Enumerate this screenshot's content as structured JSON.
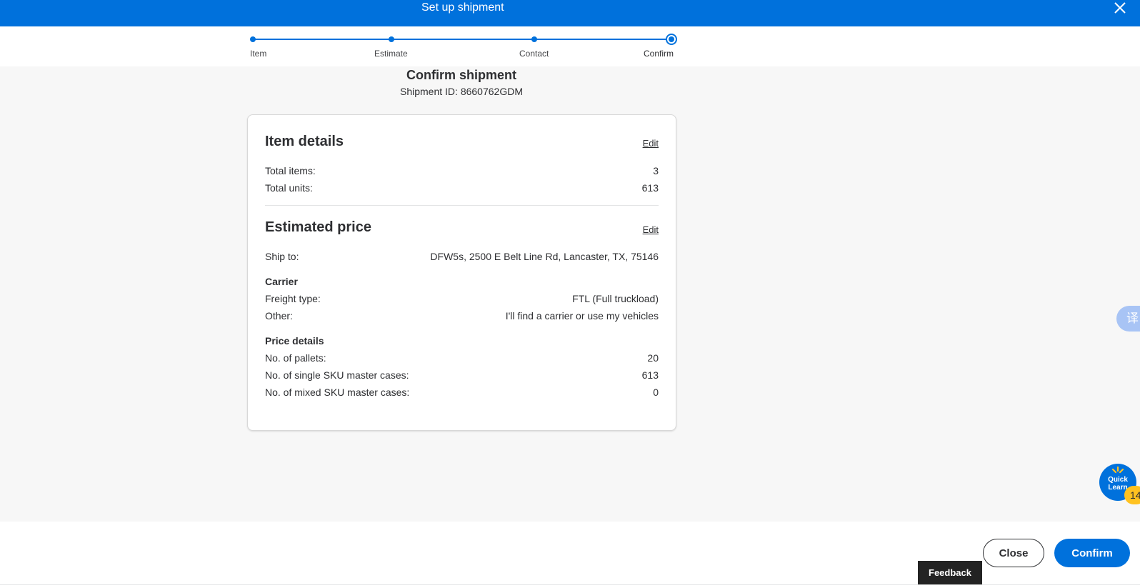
{
  "header": {
    "title": "Set up shipment"
  },
  "stepper": {
    "steps": [
      {
        "label": "Item"
      },
      {
        "label": "Estimate"
      },
      {
        "label": "Contact"
      },
      {
        "label": "Confirm"
      }
    ],
    "current_step": 4
  },
  "page": {
    "title": "Confirm shipment",
    "shipment_id": "Shipment ID: 8660762GDM"
  },
  "item_details": {
    "title": "Item details",
    "edit_label": "Edit",
    "total_items_label": "Total items:",
    "total_items_value": "3",
    "total_units_label": "Total units:",
    "total_units_value": "613"
  },
  "estimated_price": {
    "title": "Estimated price",
    "edit_label": "Edit",
    "ship_to_label": "Ship to:",
    "ship_to_value": "DFW5s, 2500 E Belt Line Rd, Lancaster, TX, 75146",
    "carrier_heading": "Carrier",
    "freight_type_label": "Freight type:",
    "freight_type_value": "FTL (Full truckload)",
    "other_label": "Other:",
    "other_value": "I'll find a carrier or use my vehicles",
    "price_details_heading": "Price details",
    "pallets_label": "No. of pallets:",
    "pallets_value": "20",
    "single_sku_label": "No. of single SKU master cases:",
    "single_sku_value": "613",
    "mixed_sku_label": "No. of mixed SKU master cases:",
    "mixed_sku_value": "0"
  },
  "widgets": {
    "translate_glyph": "译",
    "quick_learn_line1": "Quick",
    "quick_learn_line2": "Learn",
    "quick_learn_badge": "14"
  },
  "footer": {
    "close_label": "Close",
    "confirm_label": "Confirm",
    "feedback_label": "Feedback"
  },
  "colors": {
    "brand_blue": "#0071dc",
    "spark_yellow": "#ffc220",
    "text_dark": "#2e2f32",
    "background_gray": "#f7f7f7"
  }
}
